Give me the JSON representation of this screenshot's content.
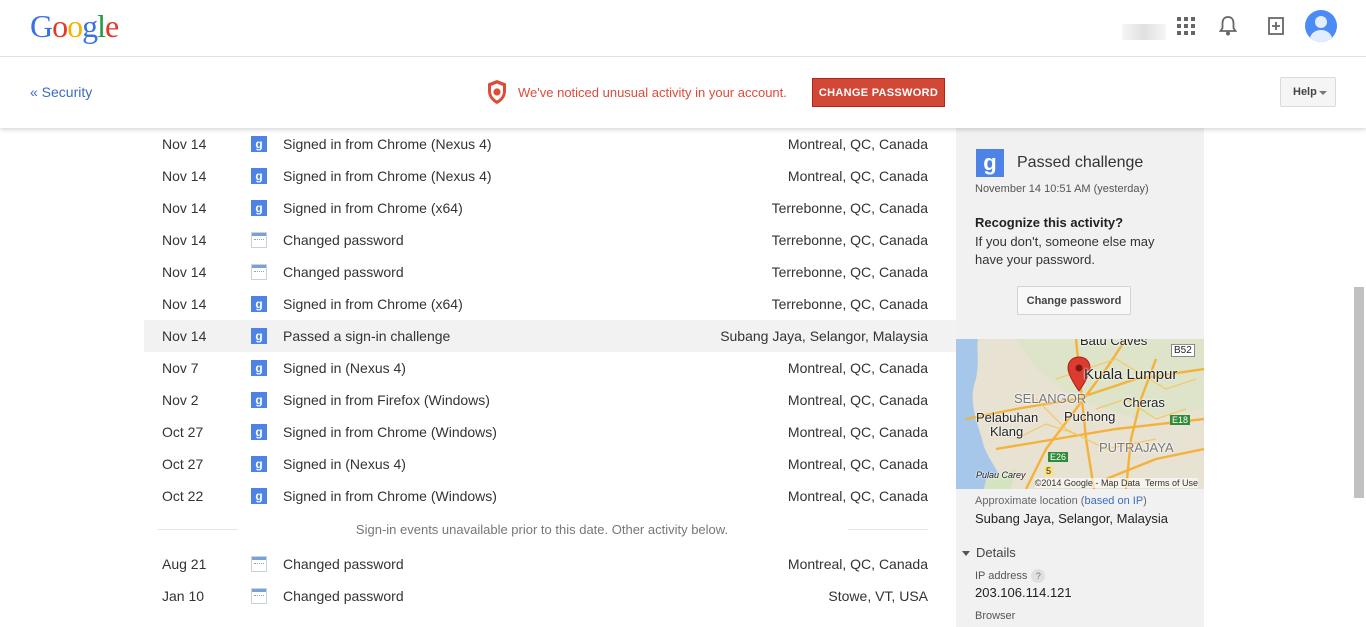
{
  "header": {
    "logo": [
      "G",
      "o",
      "o",
      "g",
      "l",
      "e"
    ],
    "logo_colors": [
      "#3a71e8",
      "#e13a2c",
      "#f5b400",
      "#3a71e8",
      "#239c45",
      "#e13a2c"
    ],
    "icons": [
      "apps-grid-icon",
      "notifications-bell-icon",
      "share-plus-icon",
      "account-avatar"
    ]
  },
  "subbar": {
    "back_label": "« Security",
    "alert_text": "We've noticed unusual activity in your account.",
    "change_password_button": "CHANGE PASSWORD",
    "help_label": "Help"
  },
  "activity": [
    {
      "date": "Nov 14",
      "icon": "google",
      "desc": "Signed in from Chrome (Nexus 4)",
      "loc": "Montreal, QC, Canada"
    },
    {
      "date": "Nov 14",
      "icon": "google",
      "desc": "Signed in from Chrome (Nexus 4)",
      "loc": "Montreal, QC, Canada"
    },
    {
      "date": "Nov 14",
      "icon": "google",
      "desc": "Signed in from Chrome (x64)",
      "loc": "Terrebonne, QC, Canada"
    },
    {
      "date": "Nov 14",
      "icon": "password",
      "desc": "Changed password",
      "loc": "Terrebonne, QC, Canada"
    },
    {
      "date": "Nov 14",
      "icon": "password",
      "desc": "Changed password",
      "loc": "Terrebonne, QC, Canada"
    },
    {
      "date": "Nov 14",
      "icon": "google",
      "desc": "Signed in from Chrome (x64)",
      "loc": "Terrebonne, QC, Canada"
    },
    {
      "date": "Nov 14",
      "icon": "google",
      "desc": "Passed a sign-in challenge",
      "loc": "Subang Jaya, Selangor, Malaysia",
      "selected": true
    },
    {
      "date": "Nov 7",
      "icon": "google",
      "desc": "Signed in (Nexus 4)",
      "loc": "Montreal, QC, Canada"
    },
    {
      "date": "Nov 2",
      "icon": "google",
      "desc": "Signed in from Firefox (Windows)",
      "loc": "Montreal, QC, Canada"
    },
    {
      "date": "Oct 27",
      "icon": "google",
      "desc": "Signed in from Chrome (Windows)",
      "loc": "Montreal, QC, Canada"
    },
    {
      "date": "Oct 27",
      "icon": "google",
      "desc": "Signed in (Nexus 4)",
      "loc": "Montreal, QC, Canada"
    },
    {
      "date": "Oct 22",
      "icon": "google",
      "desc": "Signed in from Chrome (Windows)",
      "loc": "Montreal, QC, Canada"
    }
  ],
  "divider_message": "Sign-in events unavailable prior to this date. Other activity below.",
  "other_activity": [
    {
      "date": "Aug 21",
      "icon": "password",
      "desc": "Changed password",
      "loc": "Montreal, QC, Canada"
    },
    {
      "date": "Jan 10",
      "icon": "password",
      "desc": "Changed password",
      "loc": "Stowe, VT, USA"
    }
  ],
  "panel": {
    "title": "Passed challenge",
    "when": "November 14 10:51 AM (yesterday)",
    "recognize_heading": "Recognize this activity?",
    "recognize_text": "If you don't, someone else may have your password.",
    "change_password_button": "Change password",
    "map": {
      "labels": [
        "Batu Caves",
        "B52",
        "Kuala Lumpur",
        "SELANGOR",
        "Pelabuhan",
        "Klang",
        "Puchong",
        "Cheras",
        "E18",
        "E26",
        "PUTRAJAYA",
        "5",
        "Pulau Carey"
      ],
      "credit": "©2014 Google - Map Data",
      "terms": "Terms of Use"
    },
    "approx_prefix": "Approximate location (",
    "approx_link": "based on IP",
    "approx_suffix": ")",
    "approx_location": "Subang Jaya, Selangor, Malaysia",
    "details_label": "Details",
    "ip_label": "IP address",
    "ip_help": "?",
    "ip_value": "203.106.114.121",
    "browser_label": "Browser"
  }
}
